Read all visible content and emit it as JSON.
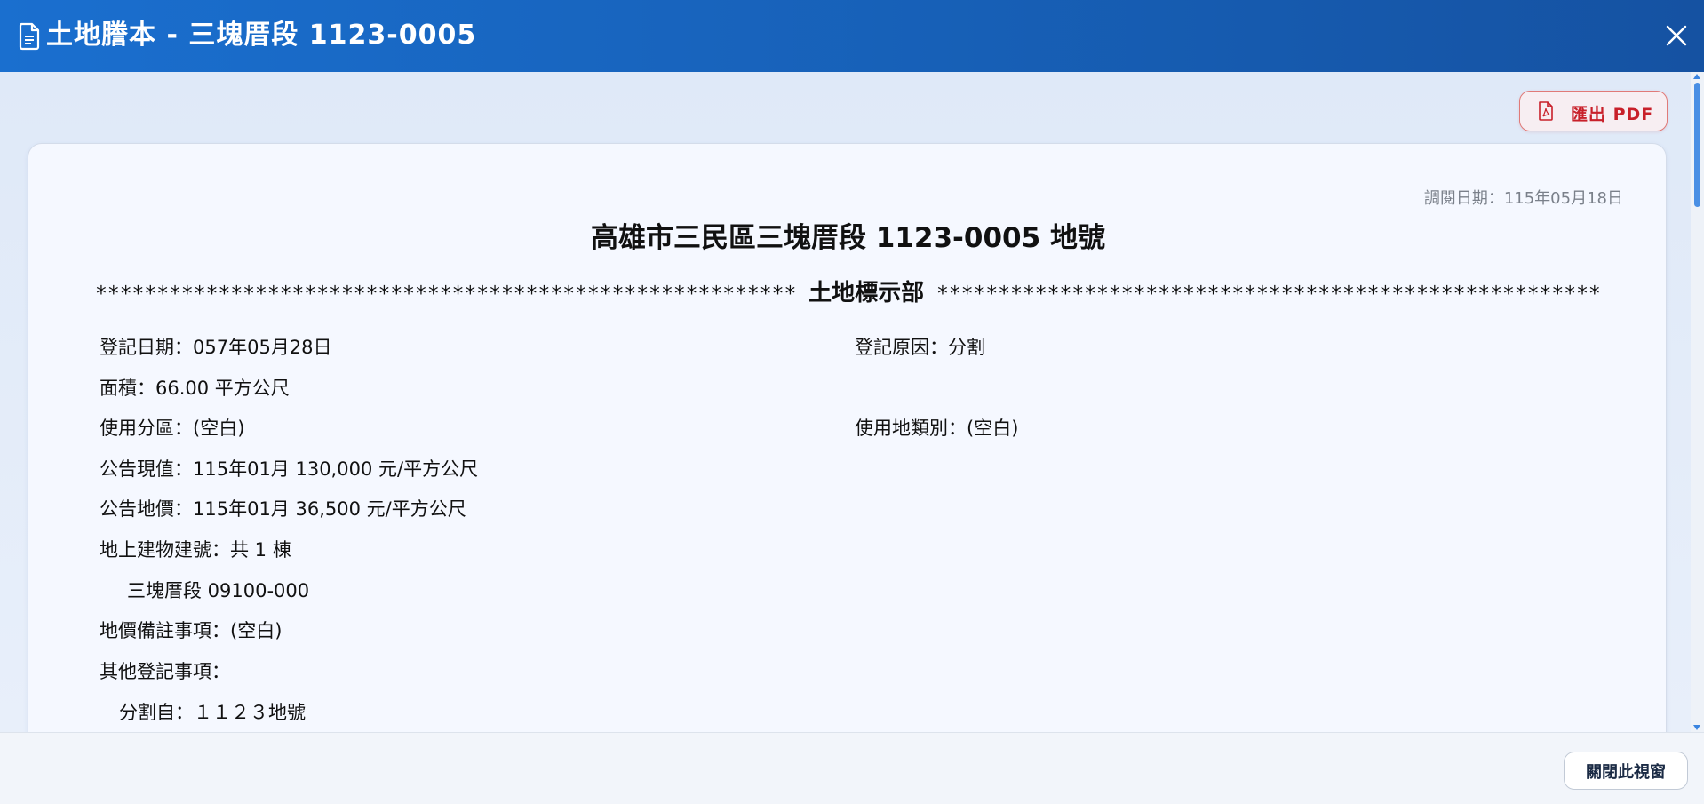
{
  "window": {
    "title": "土地謄本 - 三塊厝段 1123-0005",
    "title_icon": "document-icon",
    "close_icon": "close-icon"
  },
  "toolbar": {
    "export_label": "匯出 PDF",
    "export_icon": "pdf-icon"
  },
  "document": {
    "view_date": "調閱日期：115年05月18日",
    "title": "高雄市三民區三塊厝段 1123-0005 地號",
    "section_stars_left": "*********************************************************",
    "section_name": "土地標示部",
    "section_stars_right": "*********************************************************",
    "fields": {
      "register_date": "登記日期：057年05月28日",
      "register_reason": "登記原因：分割",
      "area": "面積：66.00 平方公尺",
      "zoning": "使用分區：(空白)",
      "land_use_category": "使用地類別：(空白)",
      "announced_current_value": "公告現值：115年01月 130,000 元/平方公尺",
      "announced_land_price": "公告地價：115年01月 36,500 元/平方公尺",
      "buildings_on_land": "地上建物建號：共 1 棟",
      "building_number": "三塊厝段 09100-000",
      "land_price_remarks": "地價備註事項：(空白)",
      "other_registration": "其他登記事項：",
      "split_from": "分割自：１１２３地號"
    }
  },
  "footer": {
    "close_window_label": "關閉此視窗"
  },
  "colors": {
    "titlebar": "#1760b7",
    "export_accent": "#c8202a",
    "scroll_thumb": "#4a8fe4"
  }
}
